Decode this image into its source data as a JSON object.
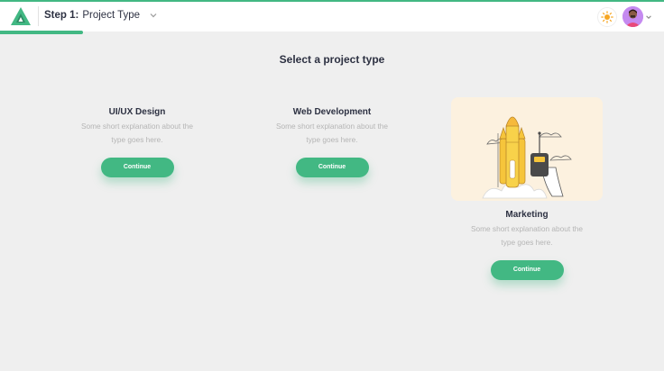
{
  "header": {
    "step_prefix": "Step 1:",
    "step_title": "Project Type",
    "progress_percent": 12.5
  },
  "main": {
    "title": "Select a project type",
    "cards": [
      {
        "title": "UI/UX Design",
        "description": "Some short explanation about the type goes here.",
        "button": "Continue"
      },
      {
        "title": "Web Development",
        "description": "Some short explanation about the type goes here.",
        "button": "Continue"
      },
      {
        "title": "Marketing",
        "description": "Some short explanation about the type goes here.",
        "button": "Continue"
      }
    ]
  },
  "icons": {
    "logo": "logo-icon",
    "theme": "sun-icon",
    "dropdown": "chevron-down-icon"
  },
  "colors": {
    "accent": "#42b883",
    "text_dark": "#2d3142",
    "text_muted": "#b5b5b5",
    "background": "#efefef",
    "illustration_bg": "#fcf1df"
  }
}
